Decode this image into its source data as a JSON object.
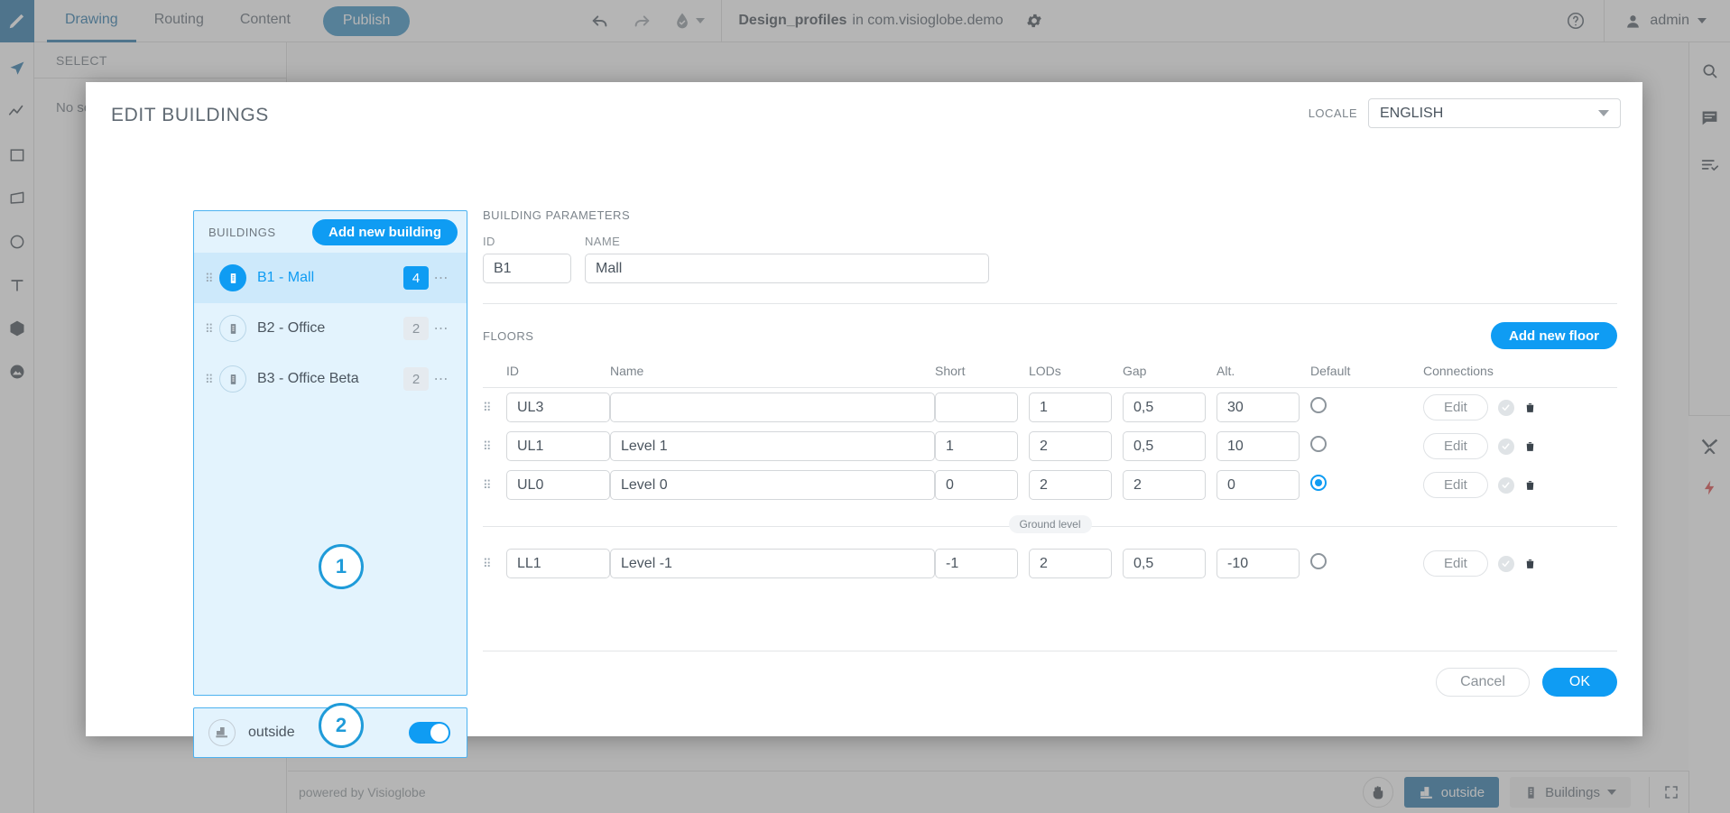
{
  "topbar": {
    "tabs": [
      {
        "label": "Drawing",
        "active": true
      },
      {
        "label": "Routing",
        "active": false
      },
      {
        "label": "Content",
        "active": false
      }
    ],
    "publish_label": "Publish",
    "undo_icon": "undo-icon",
    "redo_icon": "redo-icon",
    "validate_icon": "validate-icon",
    "doc_name": "Design_profiles",
    "doc_context": "in com.visioglobe.demo",
    "gear_icon": "gear-icon",
    "help_icon": "help-icon",
    "user_name": "admin",
    "user_icon": "user-icon"
  },
  "left_rail": {
    "items": [
      {
        "icon": "cursor-arrow-icon",
        "active": true
      },
      {
        "icon": "polyline-icon",
        "active": false
      },
      {
        "icon": "rectangle-icon",
        "active": false
      },
      {
        "icon": "polygon-icon",
        "active": false
      },
      {
        "icon": "circle-icon",
        "active": false
      },
      {
        "icon": "text-icon",
        "active": false
      },
      {
        "icon": "cube-icon",
        "active": false
      },
      {
        "icon": "image-icon",
        "active": false
      }
    ]
  },
  "right_rail": {
    "top_items": [
      {
        "icon": "search-icon"
      },
      {
        "icon": "comment-icon"
      },
      {
        "icon": "checklist-icon"
      }
    ],
    "bottom_items": [
      {
        "icon": "tools-icon"
      },
      {
        "icon": "lightning-icon"
      }
    ]
  },
  "select_panel": {
    "header": "SELECT",
    "empty_text": "No selection"
  },
  "bottombar": {
    "powered_by": "powered by Visioglobe",
    "hand_icon": "hand-icon",
    "outside_label": "outside",
    "outside_icon": "building-outside-icon",
    "buildings_label": "Buildings",
    "buildings_icon": "building-icon",
    "buildings_caret": "caret-down-icon",
    "fullscreen_icon": "fullscreen-icon"
  },
  "modal": {
    "title": "EDIT BUILDINGS",
    "locale_label": "LOCALE",
    "locale_value": "ENGLISH",
    "locale_caret": "chevron-down-icon",
    "buildings": {
      "header": "BUILDINGS",
      "add_label": "Add new building",
      "items": [
        {
          "name": "B1 - Mall",
          "count": "4",
          "selected": true
        },
        {
          "name": "B2 - Office",
          "count": "2",
          "selected": false
        },
        {
          "name": "B3 - Office Beta",
          "count": "2",
          "selected": false
        }
      ],
      "menu_icon": "ellipsis-icon",
      "drag_icon": "drag-handle-icon",
      "building_icon": "building-icon"
    },
    "badges": [
      {
        "number": "1"
      },
      {
        "number": "2"
      }
    ],
    "outside": {
      "label": "outside",
      "icon": "building-outside-icon",
      "toggle_on": true
    },
    "parameters": {
      "section_label": "BUILDING PARAMETERS",
      "id_label": "ID",
      "id_value": "B1",
      "name_label": "NAME",
      "name_value": "Mall"
    },
    "floors": {
      "section_label": "FLOORS",
      "add_label": "Add new floor",
      "columns": [
        "ID",
        "Name",
        "Short",
        "LODs",
        "Gap",
        "Alt.",
        "Default",
        "Connections"
      ],
      "ground_separator": "Ground level",
      "edit_label": "Edit",
      "check_icon": "check-circle-icon",
      "delete_icon": "trash-icon",
      "rows_above": [
        {
          "id": "UL3",
          "name": "",
          "name_placeholder": "",
          "short": "",
          "lods": "1",
          "gap": "0,5",
          "alt": "30",
          "default": false
        },
        {
          "id": "UL1",
          "name": "Level 1",
          "short": "1",
          "lods": "2",
          "gap": "0,5",
          "alt": "10",
          "default": false
        },
        {
          "id": "UL0",
          "name": "Level 0",
          "short": "0",
          "lods": "2",
          "gap": "2",
          "alt": "0",
          "default": true
        }
      ],
      "rows_below": [
        {
          "id": "LL1",
          "name": "Level -1",
          "short": "-1",
          "lods": "2",
          "gap": "0,5",
          "alt": "-10",
          "default": false
        }
      ]
    },
    "footer": {
      "cancel_label": "Cancel",
      "ok_label": "OK"
    }
  },
  "colors": {
    "brand_blue": "#0f9cf3",
    "dark_blue": "#1d6fa5",
    "panel_blue_bg": "#e3f3fd",
    "panel_blue_border": "#4db2f0",
    "selected_row": "#cde9fb",
    "accent_red": "#d93a3a"
  }
}
